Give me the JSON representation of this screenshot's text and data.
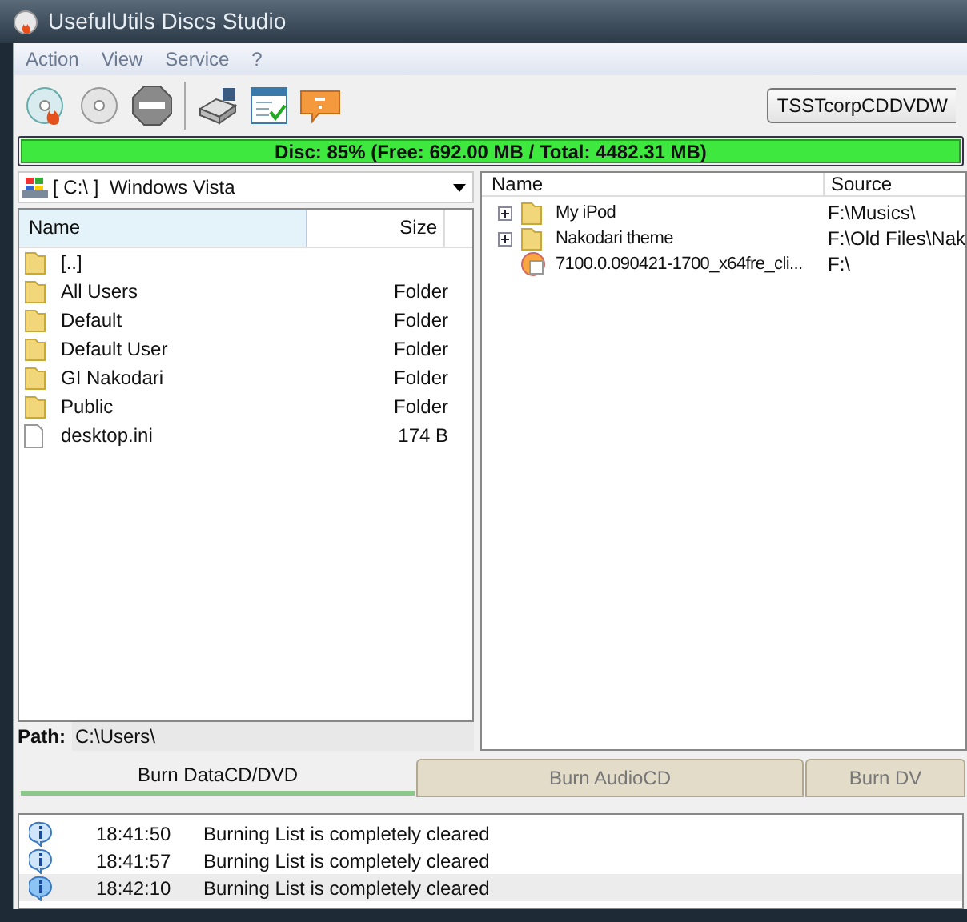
{
  "window": {
    "title": "UsefulUtils Discs Studio"
  },
  "menu": [
    "Action",
    "View",
    "Service",
    "?"
  ],
  "toolbar": {
    "drive": "TSSTcorpCDDVDW"
  },
  "disc_bar": {
    "text": "Disc: 85% (Free: 692.00 MB / Total: 4482.31 MB)"
  },
  "drive_combo": {
    "value": "[ C:\\ ]  Windows Vista"
  },
  "file_list": {
    "columns": [
      "Name",
      "Size"
    ],
    "rows": [
      {
        "kind": "folder",
        "name": "[..]",
        "size": ""
      },
      {
        "kind": "folder",
        "name": "All Users",
        "size": "Folder"
      },
      {
        "kind": "folder",
        "name": "Default",
        "size": "Folder"
      },
      {
        "kind": "folder",
        "name": "Default User",
        "size": "Folder"
      },
      {
        "kind": "folder",
        "name": "GI Nakodari",
        "size": "Folder"
      },
      {
        "kind": "folder",
        "name": "Public",
        "size": "Folder"
      },
      {
        "kind": "file",
        "name": "desktop.ini",
        "size": "174 B"
      }
    ]
  },
  "path": {
    "label": "Path:",
    "value": "C:\\Users\\"
  },
  "burn_list": {
    "columns": [
      "Name",
      "Source"
    ],
    "rows": [
      {
        "kind": "folder",
        "name": "My iPod",
        "source": "F:\\Musics\\"
      },
      {
        "kind": "folder",
        "name": "Nakodari theme",
        "source": "F:\\Old Files\\Nak"
      },
      {
        "kind": "image",
        "name": "7100.0.090421-1700_x64fre_cli...",
        "source": "F:\\"
      }
    ]
  },
  "tabs": [
    {
      "label": "Burn DataCD/DVD",
      "selected": true
    },
    {
      "label": "Burn AudioCD",
      "selected": false
    },
    {
      "label": "Burn DV",
      "selected": false
    }
  ],
  "log": [
    {
      "time": "18:41:50",
      "message": "Burning List is completely cleared",
      "selected": false
    },
    {
      "time": "18:41:57",
      "message": "Burning List is completely cleared",
      "selected": false
    },
    {
      "time": "18:42:10",
      "message": "Burning List is completely cleared",
      "selected": true
    }
  ]
}
